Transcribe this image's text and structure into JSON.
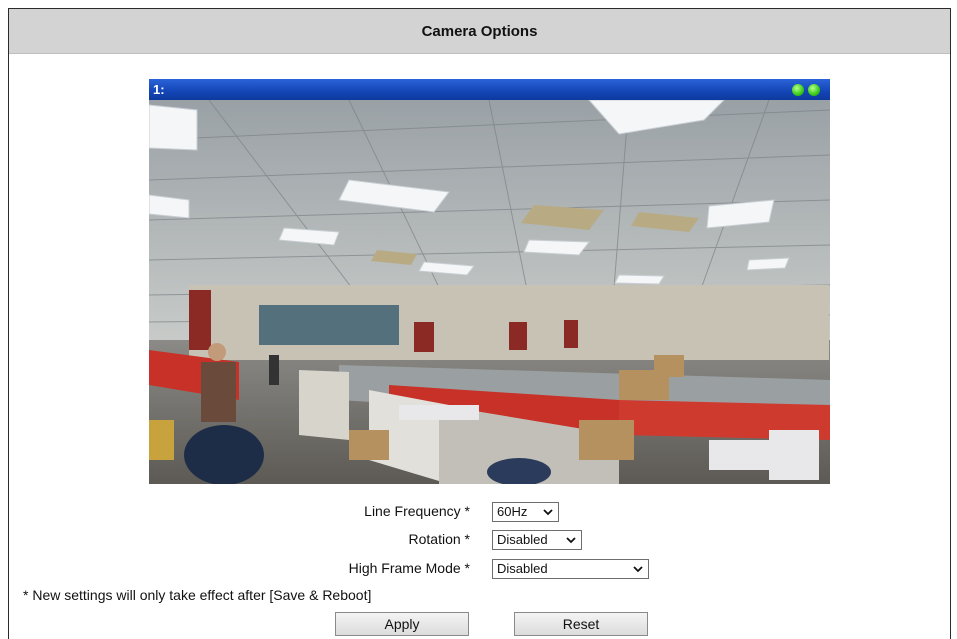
{
  "header": {
    "title": "Camera Options"
  },
  "viewer": {
    "channel_label": "1:",
    "status_icon": "green-dot-icon"
  },
  "form": {
    "line_frequency": {
      "label": "Line Frequency *",
      "value": "60Hz"
    },
    "rotation": {
      "label": "Rotation *",
      "value": "Disabled"
    },
    "high_frame_mode": {
      "label": "High Frame Mode *",
      "value": "Disabled"
    }
  },
  "note": "* New settings will only take effect after [Save & Reboot]",
  "buttons": {
    "apply": "Apply",
    "reset": "Reset"
  }
}
